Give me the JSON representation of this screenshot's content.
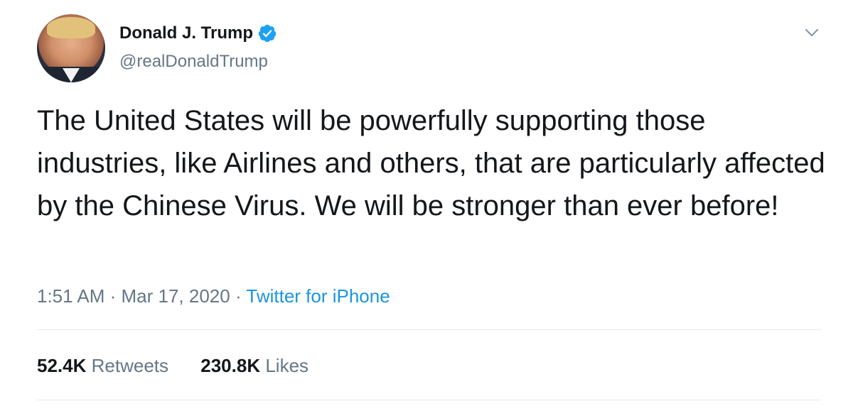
{
  "author": {
    "display_name": "Donald J. Trump",
    "handle": "@realDonaldTrump",
    "verified": true
  },
  "tweet": {
    "text": "The United States will be powerfully supporting those industries, like Airlines and others, that are particularly affected by the Chinese Virus. We will be stronger than ever before!",
    "time": "1:51 AM",
    "separator_1": " · ",
    "date": "Mar 17, 2020",
    "separator_2": " · ",
    "source": "Twitter for iPhone"
  },
  "stats": {
    "retweets_count": "52.4K",
    "retweets_label": "Retweets",
    "likes_count": "230.8K",
    "likes_label": "Likes"
  },
  "icons": {
    "verified": "verified-badge-icon",
    "menu": "chevron-down-icon"
  },
  "colors": {
    "verified_blue": "#1da1f2",
    "link_blue": "#1b95e0",
    "secondary_text": "#657786",
    "primary_text": "#14171a"
  }
}
